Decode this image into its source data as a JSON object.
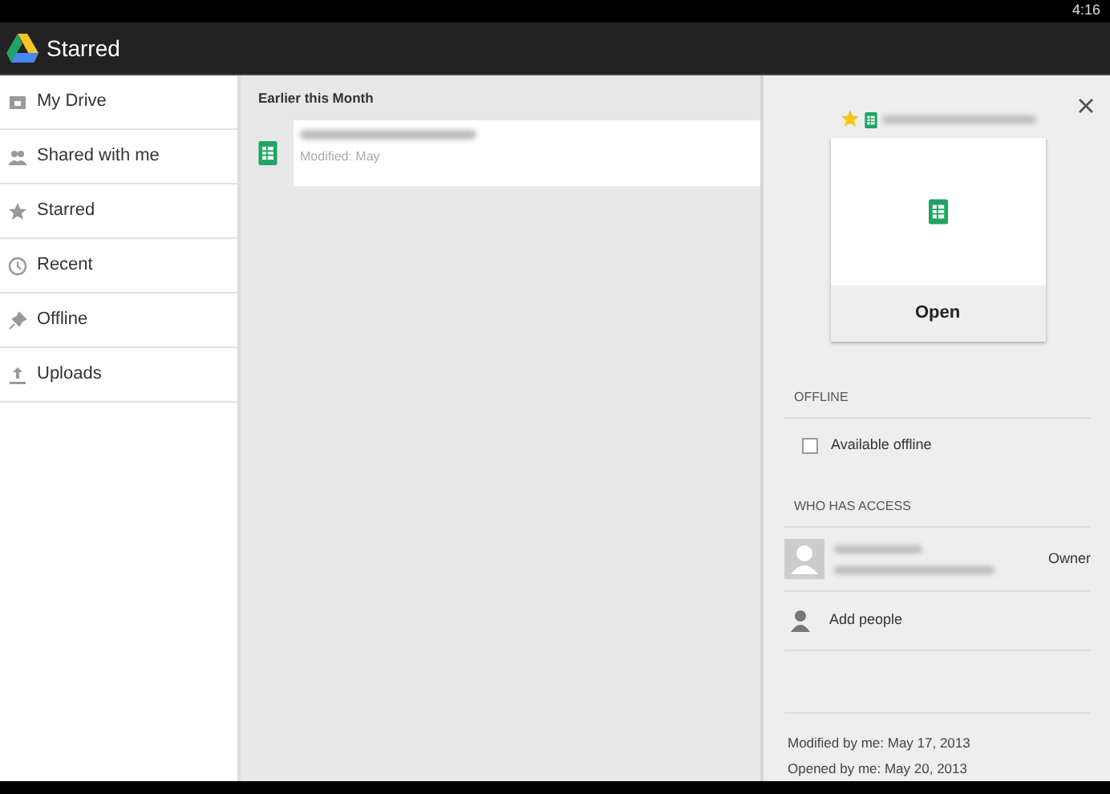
{
  "status_bar": {
    "time": "4:16"
  },
  "action_bar": {
    "title": "Starred"
  },
  "sidebar": {
    "items": [
      {
        "label": "My Drive",
        "kind": "drive"
      },
      {
        "label": "Shared with me",
        "kind": "people"
      },
      {
        "label": "Starred",
        "kind": "star"
      },
      {
        "label": "Recent",
        "kind": "clock"
      },
      {
        "label": "Offline",
        "kind": "pin"
      },
      {
        "label": "Uploads",
        "kind": "upload"
      }
    ]
  },
  "file_list": {
    "section": "Earlier this Month",
    "files": [
      {
        "modified": "Modified: May"
      }
    ]
  },
  "details": {
    "starred": true,
    "open_button": "Open",
    "offline": {
      "heading": "OFFLINE",
      "label": "Available offline",
      "checked": false
    },
    "access": {
      "heading": "WHO HAS ACCESS",
      "people": [
        {
          "role": "Owner"
        }
      ],
      "add_label": "Add people"
    },
    "info": [
      "Modified by me: May 17, 2013",
      "Opened by me: May 20, 2013"
    ]
  }
}
